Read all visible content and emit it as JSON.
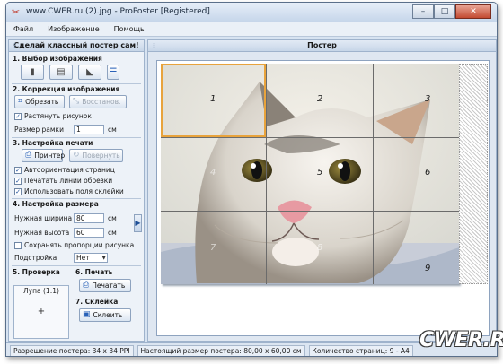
{
  "window": {
    "title": "www.CWER.ru (2).jpg - ProPoster [Registered]",
    "controls": [
      "–",
      "□",
      "✕"
    ]
  },
  "menu": [
    "Файл",
    "Изображение",
    "Помощь"
  ],
  "left_panel": {
    "header": "Сделай классный постер сам!",
    "sections": {
      "select_image": "1. Выбор изображения",
      "correction": "2. Коррекция изображения",
      "print_setup": "3. Настройка печати",
      "size_setup": "4. Настройка размера",
      "check": "5. Проверка",
      "print": "6. Печать",
      "glue": "7. Склейка"
    },
    "buttons": {
      "crop": "Обрезать",
      "restore": "Восстанов.",
      "printer": "Принтер",
      "rotate": "Повернуть",
      "print": "Печатать",
      "glue": "Склеить"
    },
    "stretch_label": "Растянуть рисунок",
    "frame_label": "Размер рамки",
    "frame_value": "1",
    "frame_unit": "см",
    "print_options": [
      "Автоориентация страниц",
      "Печатать линии обрезки",
      "Использовать поля склейки"
    ],
    "width_label": "Нужная ширина",
    "width_value": "80",
    "height_label": "Нужная высота",
    "height_value": "60",
    "size_unit": "см",
    "keep_ratio_label": "Сохранять пропорции рисунка",
    "fit_label": "Подстройка",
    "fit_value": "Нет",
    "loupe_title": "Лупа (1:1)"
  },
  "right_panel": {
    "header": "Постер",
    "pages": [
      "1",
      "2",
      "3",
      "4",
      "5",
      "6",
      "7",
      "8",
      "9"
    ]
  },
  "status": {
    "resolution": "Разрешение постера: 34 x 34 PPI",
    "actual_size": "Настоящий размер постера: 80,00 x 60,00 см",
    "page_count": "Количество страниц: 9 - A4"
  },
  "watermark": "CWER.RU",
  "colors": {
    "accent": "#2a62b8",
    "selection": "#e8a33c"
  }
}
